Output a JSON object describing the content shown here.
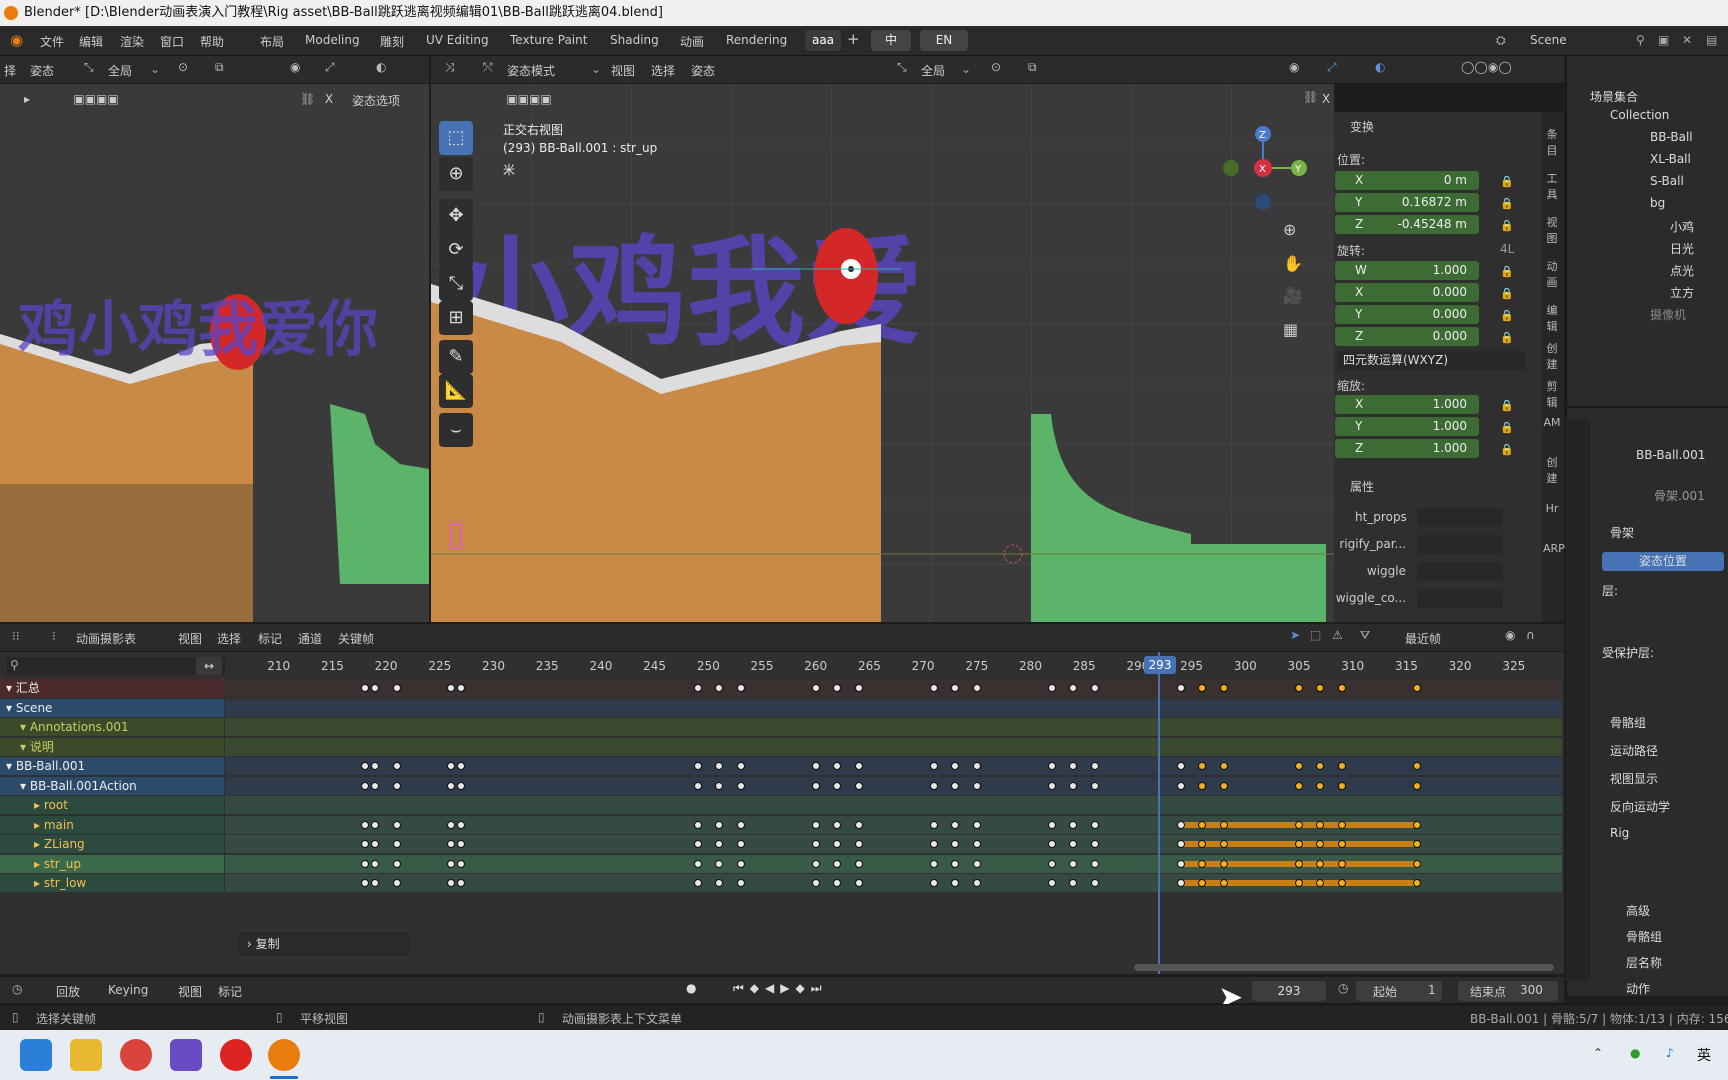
{
  "title_bar": {
    "text": "Blender* [D:\\Blender动画表演入门教程\\Rig asset\\BB-Ball跳跃逃离视频编辑01\\BB-Ball跳跃逃离04.blend]"
  },
  "menu": {
    "file": "文件",
    "edit": "编辑",
    "render": "渲染",
    "window": "窗口",
    "help": "帮助"
  },
  "workspaces": [
    "布局",
    "Modeling",
    "雕刻",
    "UV Editing",
    "Texture Paint",
    "Shading",
    "动画",
    "Rendering",
    "aaa"
  ],
  "lang_buttons": {
    "zh": "中",
    "en": "EN"
  },
  "scene_name": "Scene",
  "left_view": {
    "select": "择",
    "pose": "姿态",
    "global": "全局",
    "pose_options": "姿态选项",
    "overlay_text": "鸡小鸡我爱你"
  },
  "main_view": {
    "mode": "姿态模式",
    "menu_view": "视图",
    "menu_select": "选择",
    "menu_pose": "姿态",
    "global": "全局",
    "pose_options": "姿态选项",
    "info_line1": "正交右视图",
    "info_line2": "(293) BB-Ball.001 : str_up",
    "info_line3": "米",
    "overlay_text": "小鸡我爱",
    "gizmo_z": "Z",
    "gizmo_y": "Y",
    "gizmo_x": "X"
  },
  "npanel": {
    "transform_header": "变换",
    "location": "位置:",
    "loc": [
      {
        "axis": "X",
        "value": "0 m"
      },
      {
        "axis": "Y",
        "value": "0.16872 m"
      },
      {
        "axis": "Z",
        "value": "-0.45248 m"
      }
    ],
    "rotation": "旋转:",
    "rot_mode_4l": "4L",
    "rot": [
      {
        "axis": "W",
        "value": "1.000"
      },
      {
        "axis": "X",
        "value": "0.000"
      },
      {
        "axis": "Y",
        "value": "0.000"
      },
      {
        "axis": "Z",
        "value": "0.000"
      }
    ],
    "rot_mode": "四元数运算(WXYZ)",
    "scale": "缩放:",
    "scl": [
      {
        "axis": "X",
        "value": "1.000"
      },
      {
        "axis": "Y",
        "value": "1.000"
      },
      {
        "axis": "Z",
        "value": "1.000"
      }
    ],
    "props_header": "属性",
    "props": [
      "ht_props",
      "rigify_par...",
      "wiggle",
      "wiggle_co..."
    ],
    "side_tabs": [
      "条目",
      "工具",
      "视图",
      "动画",
      "编辑",
      "创建",
      "剪辑",
      "AM",
      "创建",
      "Hr",
      "ARP"
    ]
  },
  "outliner": {
    "root": "场景集合",
    "items": [
      "Collection",
      "BB-Ball",
      "XL-Ball",
      "S-Ball",
      "bg",
      "小鸡",
      "日光",
      "点光",
      "立方",
      "摄像机"
    ]
  },
  "properties": {
    "object": "BB-Ball.001",
    "armature": "骨架.001",
    "skeleton": "骨架",
    "pose_position": "姿态位置",
    "layers": "层:",
    "protected_layers": "受保护层:",
    "sections": [
      "骨骼组",
      "运动路径",
      "视图显示",
      "反向运动学",
      "Rig"
    ],
    "subsections": [
      "高级",
      "骨骼组",
      "层名称",
      "动作"
    ]
  },
  "dopesheet": {
    "editor": "动画摄影表",
    "menus": [
      "视图",
      "选择",
      "标记",
      "通道",
      "关键帧"
    ],
    "nearest": "最近帧",
    "frame_ticks": [
      210,
      215,
      220,
      225,
      230,
      235,
      240,
      245,
      250,
      255,
      260,
      265,
      270,
      275,
      280,
      285,
      290,
      295,
      300,
      305,
      310,
      315,
      320,
      325
    ],
    "current_frame": 293,
    "channels": [
      {
        "name": "汇总",
        "indent": 0,
        "kind": "summary"
      },
      {
        "name": "Scene",
        "indent": 0,
        "kind": "scene"
      },
      {
        "name": "Annotations.001",
        "indent": 1,
        "kind": "anno"
      },
      {
        "name": "说明",
        "indent": 1,
        "kind": "note"
      },
      {
        "name": "BB-Ball.001",
        "indent": 0,
        "kind": "object"
      },
      {
        "name": "BB-Ball.001Action",
        "indent": 1,
        "kind": "action"
      },
      {
        "name": "root",
        "indent": 2,
        "kind": "group"
      },
      {
        "name": "main",
        "indent": 2,
        "kind": "group"
      },
      {
        "name": "ZLiang",
        "indent": 2,
        "kind": "group"
      },
      {
        "name": "str_up",
        "indent": 2,
        "kind": "group-sel"
      },
      {
        "name": "str_low",
        "indent": 2,
        "kind": "group"
      }
    ],
    "keyframes_white": [
      218,
      219,
      221,
      226,
      227,
      249,
      251,
      253,
      260,
      262,
      264,
      271,
      273,
      275,
      282,
      284,
      286,
      294
    ],
    "keyframes_orange": [
      296,
      298,
      305,
      307,
      309,
      316
    ],
    "copy_panel": "复制"
  },
  "timeline": {
    "playback": "回放",
    "keying": "Keying",
    "view": "视图",
    "marker": "标记",
    "frame": "293",
    "start_label": "起始",
    "start": "1",
    "end_label": "结束点",
    "end": "300"
  },
  "statusbar": {
    "select_keys": "选择关键帧",
    "pan_view": "平移视图",
    "context_menu": "动画摄影表上下文菜单",
    "stats": "BB-Ball.001 | 骨骼:5/7 | 物体:1/13 | 内存: 156."
  },
  "taskbar": {
    "ime": "英"
  },
  "colors": {
    "accent_blue": "#4772b3",
    "field_green": "#3d6b34",
    "orange_key": "#f0b020",
    "ground_orange": "#c98a48",
    "ramp_green": "#5cb46a",
    "ball_red": "#d42828"
  }
}
